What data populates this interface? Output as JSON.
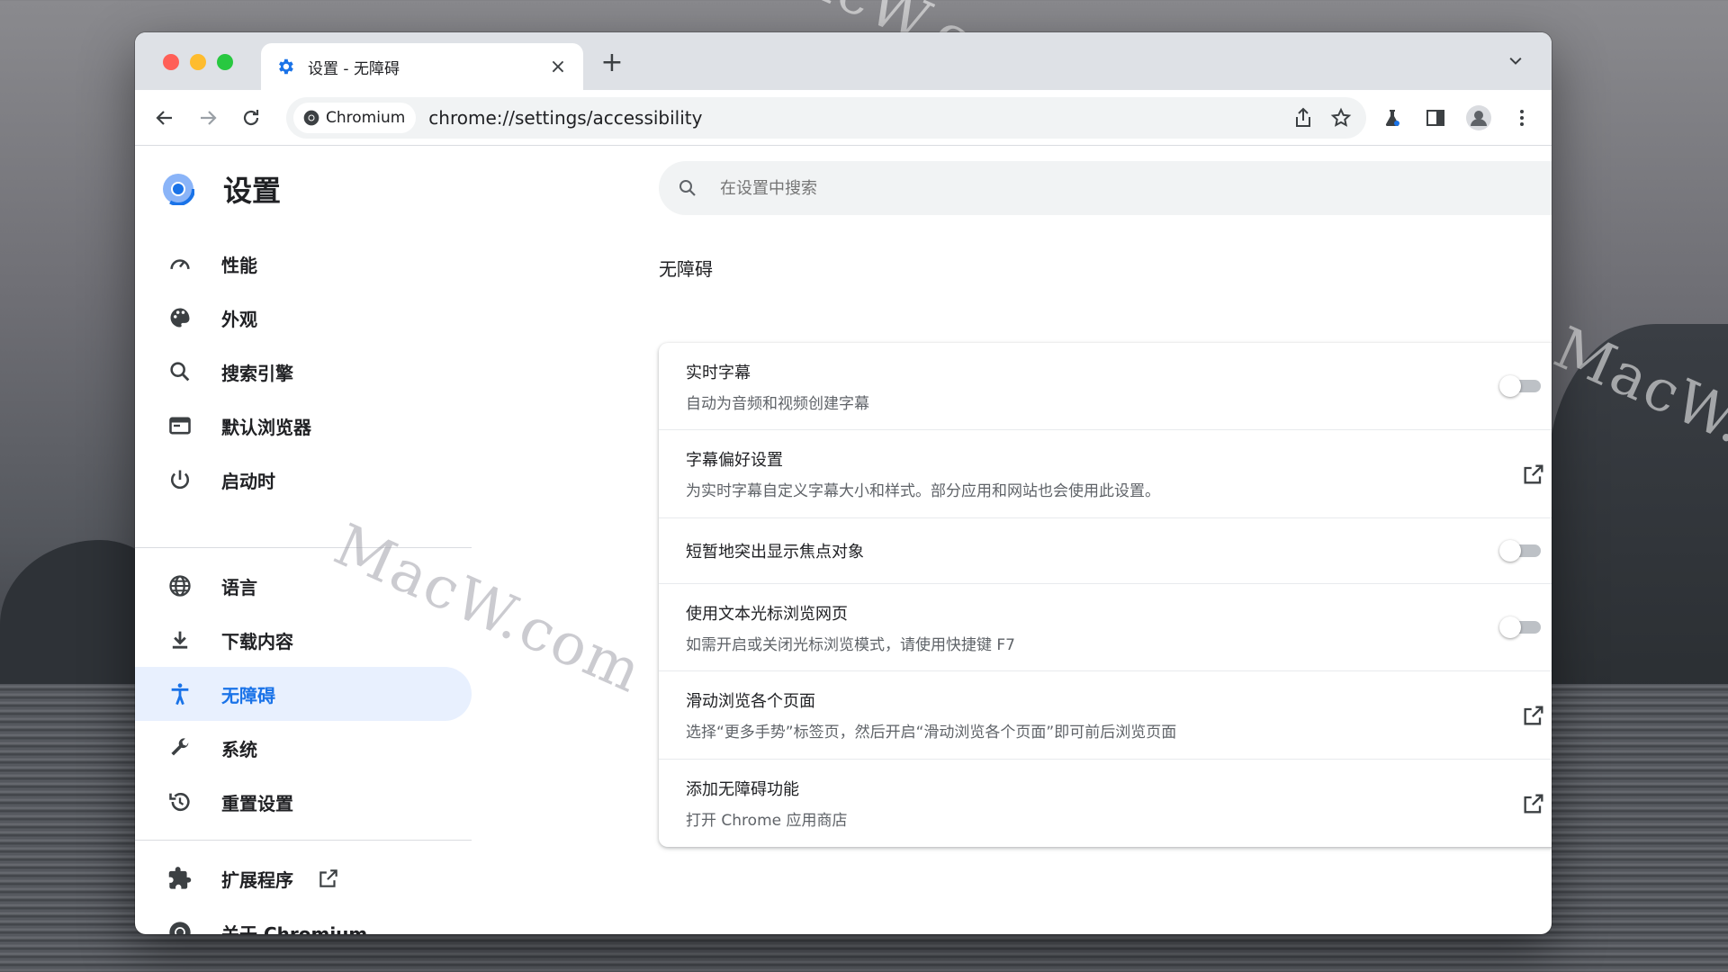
{
  "watermarks": [
    "MacW.com",
    "MacW.com",
    "MacW.c"
  ],
  "browser": {
    "tab_title": "设置 - 无障碍",
    "new_tab_label": "+",
    "close_label": "×",
    "site_chip": "Chromium",
    "url": "chrome://settings/accessibility"
  },
  "sidebar": {
    "title": "设置",
    "items": [
      {
        "label": "性能",
        "icon": "speedometer-icon"
      },
      {
        "label": "外观",
        "icon": "palette-icon"
      },
      {
        "label": "搜索引擎",
        "icon": "search-icon"
      },
      {
        "label": "默认浏览器",
        "icon": "browser-window-icon"
      },
      {
        "label": "启动时",
        "icon": "power-icon"
      },
      {
        "label": "语言",
        "icon": "globe-icon"
      },
      {
        "label": "下载内容",
        "icon": "download-icon"
      },
      {
        "label": "无障碍",
        "icon": "accessibility-icon",
        "active": true
      },
      {
        "label": "系统",
        "icon": "wrench-icon"
      },
      {
        "label": "重置设置",
        "icon": "reset-history-icon"
      },
      {
        "label": "扩展程序",
        "icon": "puzzle-icon"
      },
      {
        "label": "关于 Chromium",
        "icon": "chromium-icon"
      }
    ]
  },
  "search": {
    "placeholder": "在设置中搜索"
  },
  "section": {
    "title": "无障碍",
    "rows": [
      {
        "title": "实时字幕",
        "subtitle": "自动为音频和视频创建字幕",
        "control": "toggle",
        "on": false
      },
      {
        "title": "字幕偏好设置",
        "subtitle": "为实时字幕自定义字幕大小和样式。部分应用和网站也会使用此设置。",
        "control": "external-link"
      },
      {
        "title": "短暂地突出显示焦点对象",
        "subtitle": "",
        "control": "toggle",
        "on": false
      },
      {
        "title": "使用文本光标浏览网页",
        "subtitle": "如需开启或关闭光标浏览模式，请使用快捷键 F7",
        "control": "toggle",
        "on": false
      },
      {
        "title": "滑动浏览各个页面",
        "subtitle": "选择“更多手势”标签页，然后开启“滑动浏览各个页面”即可前后浏览页面",
        "control": "external-link"
      },
      {
        "title": "添加无障碍功能",
        "subtitle": "打开 Chrome 应用商店",
        "control": "external-link"
      }
    ]
  },
  "colors": {
    "accent": "#1a73e8",
    "active_bg": "#e8f0fe",
    "text": "#202124",
    "subtext": "#5f6368"
  }
}
